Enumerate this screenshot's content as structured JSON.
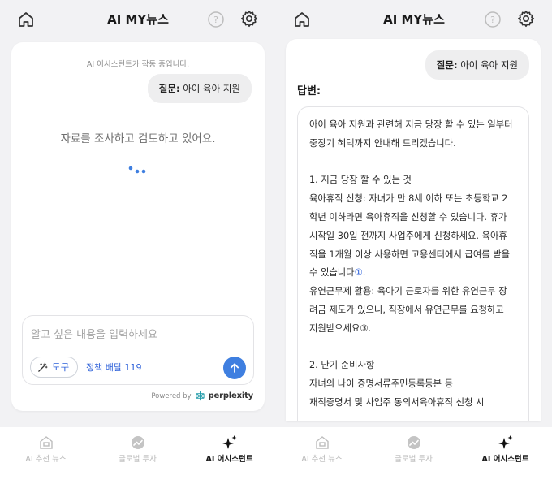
{
  "header": {
    "title": "AI MY뉴스"
  },
  "left_screen": {
    "status_text": "AI 어시스턴트가 작동 중입니다.",
    "question": {
      "label": "질문:",
      "text": "아이 육아 지원"
    },
    "research_text": "자료를 조사하고 검토하고 있어요.",
    "input": {
      "placeholder": "알고 싶은 내용을 입력하세요",
      "tool_label": "도구",
      "policy_label": "정책 배달 119"
    },
    "powered_by": {
      "text": "Powered by",
      "brand": "perplexity"
    }
  },
  "right_screen": {
    "question": {
      "label": "질문:",
      "text": "아이 육아 지원"
    },
    "answer_label": "답변:",
    "answer_lines": {
      "l1": "아이 육아 지원과 관련해 지금 당장 할 수 있는 일부터",
      "l2": "중장기 혜택까지 안내해 드리겠습니다.",
      "l3": "1. 지금 당장 할 수 있는 것",
      "l4": " 육아휴직 신청: 자녀가 만 8세 이하 또는 초등학교 2",
      "l5": "학년 이하라면 육아휴직을 신청할 수 있습니다. 휴가",
      "l6": "시작일 30일 전까지 사업주에게 신청하세요. 육아휴",
      "l7": "직을 1개월 이상 사용하면 고용센터에서 급여를 받을",
      "l8a": "수 있습니다",
      "l8cite": "①",
      "l8b": ".",
      "l9": " 유연근무제 활용: 육아기 근로자를 위한 유연근무 장",
      "l10": "려금 제도가 있으니, 직장에서 유연근무를 요청하고",
      "l11": "지원받으세요③.",
      "l12": "2. 단기 준비사항",
      "l13": " 자녀의 나이 증명서류주민등록등본 등",
      "l14": " 재직증명서 및 사업주 동의서육아휴직 신청 시"
    }
  },
  "bottom_nav": {
    "items": [
      {
        "label": "AI 추천 뉴스",
        "icon": "home-news-icon",
        "active": false
      },
      {
        "label": "글로벌 투자",
        "icon": "trend-icon",
        "active": false
      },
      {
        "label": "AI 어시스턴트",
        "icon": "sparkle-icon",
        "active": true
      }
    ]
  },
  "colors": {
    "accent": "#3f7fe0",
    "link": "#2b5fd9",
    "background": "#f2f2f4"
  }
}
